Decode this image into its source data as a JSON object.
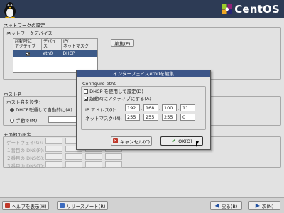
{
  "header": {
    "brand": "CentOS"
  },
  "network_settings": {
    "title": "ネットワークの設定",
    "devices_title": "ネットワークデバイス",
    "columns": [
      "起動時に\nアクティブ",
      "デバイス",
      "IP/\nネットマスク"
    ],
    "rows": [
      {
        "active": true,
        "device": "eth0",
        "ip": "DHCP"
      }
    ],
    "edit_button": "編集(E)"
  },
  "hostname": {
    "title": "ホスト名",
    "setting_label": "ホスト名を設定：",
    "dhcp_option": "DHCPを通して自動的に(A)",
    "manual_option": "手動で(M)"
  },
  "misc": {
    "title": "その他の設定",
    "gateway": "ゲートウェイ(G):",
    "dns1": "１番目の DNS(P):",
    "dns2": "２番目の DNS(S):",
    "dns3": "３番目の DNS(T):"
  },
  "dialog": {
    "title": "インターフェイスeth0を編集",
    "section": "Configure eth0",
    "use_dhcp": "DHCP を使用して設定(D)",
    "use_dhcp_checked": false,
    "activate_on_boot": "起動時にアクティブにする(A)",
    "activate_on_boot_checked": true,
    "ip_label": "IP アドレス(I):",
    "ip": [
      "192",
      "168",
      "100",
      "11"
    ],
    "netmask_label": "ネットマスク(M):",
    "netmask": [
      "255",
      "255",
      "255",
      "0"
    ],
    "cancel": "キャンセル(C)",
    "ok": "OK(O)"
  },
  "footer": {
    "help": "ヘルプを表示(H)",
    "release_notes": "リリースノート(R)",
    "back": "戻る(B)",
    "next": "次(N)"
  },
  "colors": {
    "header_bg": "#2d3b55",
    "selection": "#3d5a88",
    "dialog_title": "#3c5588"
  }
}
